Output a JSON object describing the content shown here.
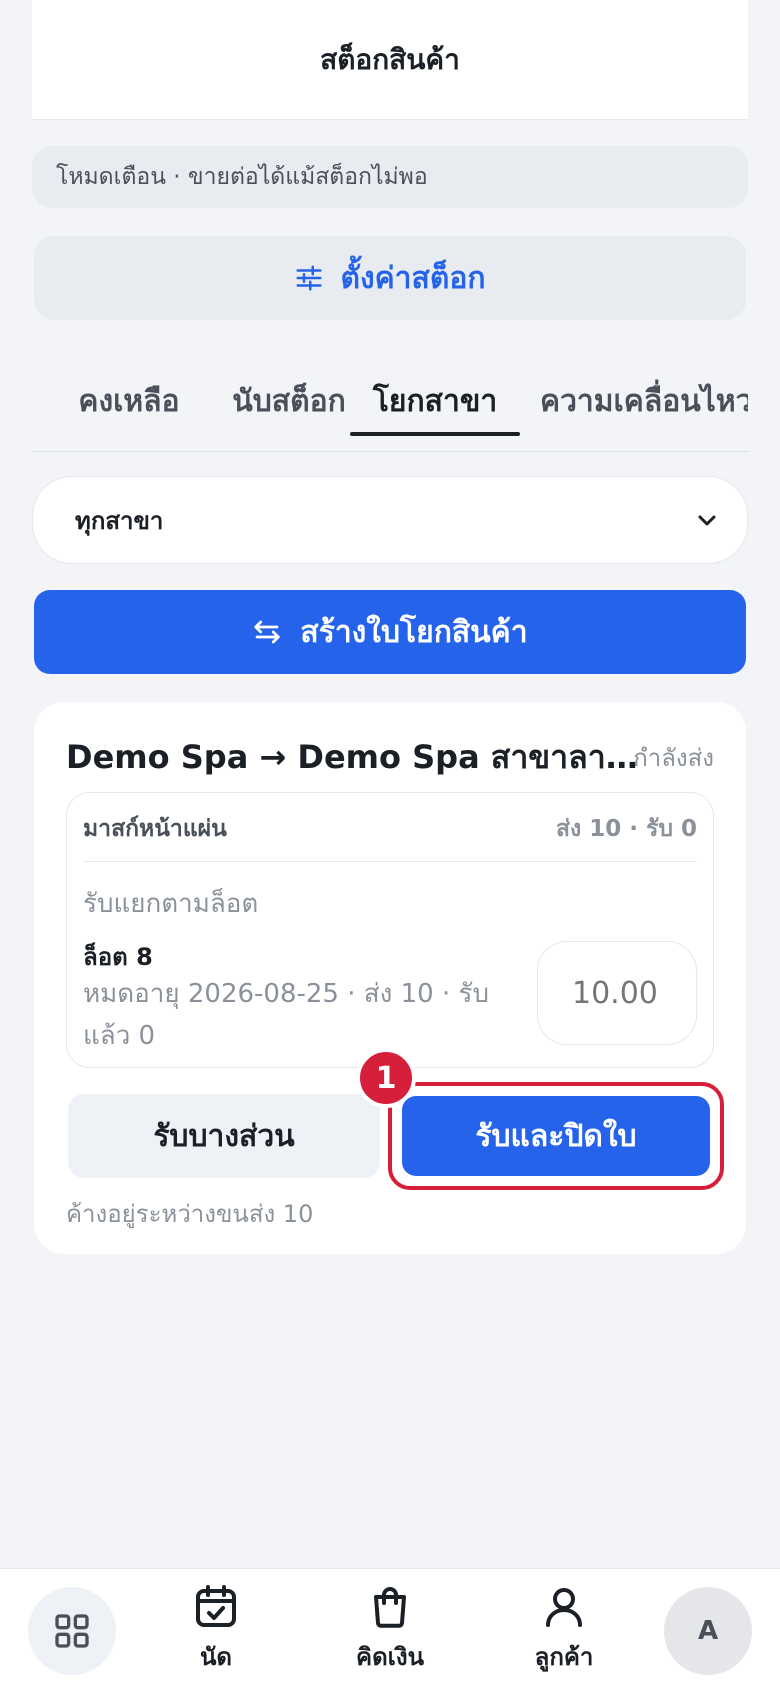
{
  "header": {
    "title": "สต็อกสินค้า"
  },
  "mode_banner": {
    "text": "โหมดเตือน · ขายต่อได้แม้สต็อกไม่พอ"
  },
  "stock_settings": {
    "label": "ตั้งค่าสต็อก",
    "icon": "sliders-icon"
  },
  "tabs": [
    {
      "label": "คงเหลือ",
      "active": false
    },
    {
      "label": "นับสต็อก",
      "active": false
    },
    {
      "label": "โยกสาขา",
      "active": true
    },
    {
      "label": "ความเคลื่อนไหว",
      "active": false
    }
  ],
  "branch_filter": {
    "selected": "ทุกสาขา"
  },
  "create_transfer": {
    "label": "สร้างใบโยกสินค้า",
    "icon": "swap-icon"
  },
  "transfer_card": {
    "title": "Demo Spa → Demo Spa สาขาลาดพร้าว",
    "status": "กำลังส่ง",
    "item": {
      "name": "มาสก์หน้าแผ่น",
      "qty_summary": "ส่ง 10 · รับ 0",
      "lot_section_label": "รับแยกตามล็อต",
      "lot": {
        "name": "ล็อต 8",
        "detail": "หมดอายุ 2026-08-25 · ส่ง 10 · รับแล้ว 0",
        "receive_placeholder": "10.00"
      }
    },
    "partial_button": "รับบางส่วน",
    "close_button": "รับและปิดใบ",
    "step_badge": "1",
    "pending_note": "ค้างอยู่ระหว่างขนส่ง 10"
  },
  "bottom_nav": {
    "items": [
      {
        "label": "นัด",
        "icon": "calendar-check-icon"
      },
      {
        "label": "คิดเงิน",
        "icon": "shopping-bag-icon"
      },
      {
        "label": "ลูกค้า",
        "icon": "user-icon"
      }
    ],
    "avatar": "A"
  },
  "colors": {
    "primary": "#2563eb",
    "highlight": "#d61f3a",
    "background": "#f2f4f7"
  }
}
